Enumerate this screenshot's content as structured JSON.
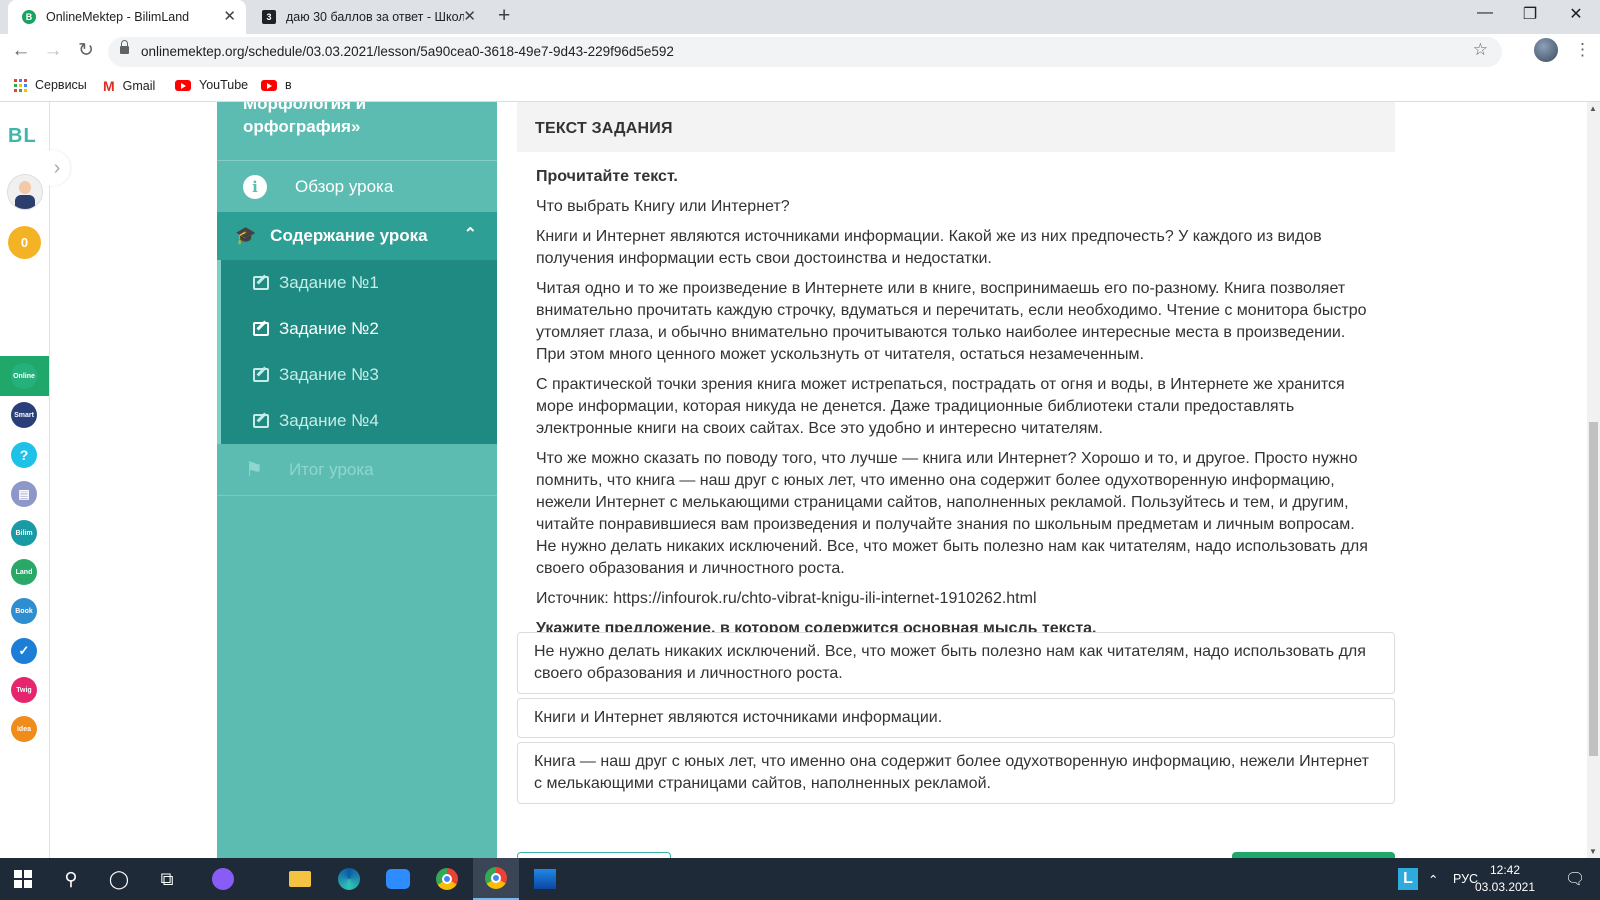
{
  "browser": {
    "tabs": [
      {
        "title": "OnlineMektep - BilimLand",
        "favicon": "B",
        "active": true
      },
      {
        "title": "даю 30 баллов за ответ - Школ",
        "favicon": "3",
        "active": false
      }
    ],
    "url": "onlinemektep.org/schedule/03.03.2021/lesson/5a90cea0-3618-49e7-9d43-229f96d5e592",
    "bookmarks": [
      "Сервисы",
      "Gmail",
      "YouTube",
      "в"
    ]
  },
  "rail": {
    "logo": "BL",
    "points": "0",
    "apps": [
      {
        "label": "Online",
        "color": "#26b07c"
      },
      {
        "label": "Smart",
        "color": "#2a3f7a"
      },
      {
        "label": "?",
        "color": "#1ec2e8"
      },
      {
        "label": "▤",
        "color": "#8e98c8"
      },
      {
        "label": "Bilim",
        "color": "#1a9aa5"
      },
      {
        "label": "Land",
        "color": "#2aa867"
      },
      {
        "label": "Book",
        "color": "#2f8ed0"
      },
      {
        "label": "✓",
        "color": "#1c7ed6"
      },
      {
        "label": "Twig",
        "color": "#e5266f"
      },
      {
        "label": "Idea",
        "color": "#f08c1a"
      }
    ]
  },
  "sidebar": {
    "course_title": "Морфология и орфография»",
    "overview_label": "Обзор урока",
    "content_label": "Содержание урока",
    "tasks": [
      "Задание №1",
      "Задание №2",
      "Задание №3",
      "Задание №4"
    ],
    "active_task": 1,
    "final_label": "Итог урока"
  },
  "main": {
    "section_title": "ТЕКСТ ЗАДАНИЯ",
    "instruction": "Прочитайте текст.",
    "heading": "Что выбрать Книгу или Интернет?",
    "paragraphs": [
      "Книги и Интернет являются источниками информации. Какой же из них предпочесть? У каждого из видов получения информации есть свои достоинства и недостатки.",
      "Читая одно и то же произведение в Интернете или в книге, воспринимаешь его по-разному. Книга позволяет внимательно прочитать каждую строчку, вдуматься и перечитать, если необходимо. Чтение с монитора быстро утомляет глаза, и обычно внимательно прочитываются только наиболее интересные места в произведении. При этом много ценного может ускользнуть от читателя, остаться незамеченным.",
      "С практической точки зрения книга может истрепаться, пострадать от огня и воды, в Интернете же хранится море информации, которая никуда не денется. Даже традиционные библиотеки стали предоставлять электронные книги на своих сайтах. Все это удобно и интересно читателям.",
      "Что же можно сказать по поводу того, что лучше — книга или Интернет? Хорошо и то, и другое. Просто нужно помнить, что книга — наш друг с юных лет, что именно она содержит более одухотворенную информацию, нежели Интернет с мелькающими страницами сайтов, наполненных рекламой. Пользуйтесь и тем, и другим, читайте понравившиеся вам произведения и получайте знания по школьным предметам и личным вопросам. Не нужно делать никаких исключений. Все, что может быть полезно нам как читателям, надо использовать для своего образования и личностного роста."
    ],
    "source": "Источник: https://infourok.ru/chto-vibrat-knigu-ili-internet-1910262.html",
    "question": "Укажите предложение, в котором содержится основная мысль текста.",
    "answers": [
      "Не нужно делать никаких исключений. Все, что может быть полезно нам как читателям, надо использовать для своего образования и личностного роста.",
      "Книги и Интернет являются источниками информации.",
      "Книга — наш друг с юных лет, что именно она содержит более одухотворенную информацию, нежели Интернет с мелькающими страницами сайтов, наполненных рекламой."
    ]
  },
  "taskbar": {
    "lang": "РУС",
    "time": "12:42",
    "date": "03.03.2021",
    "tray_app": "L"
  }
}
